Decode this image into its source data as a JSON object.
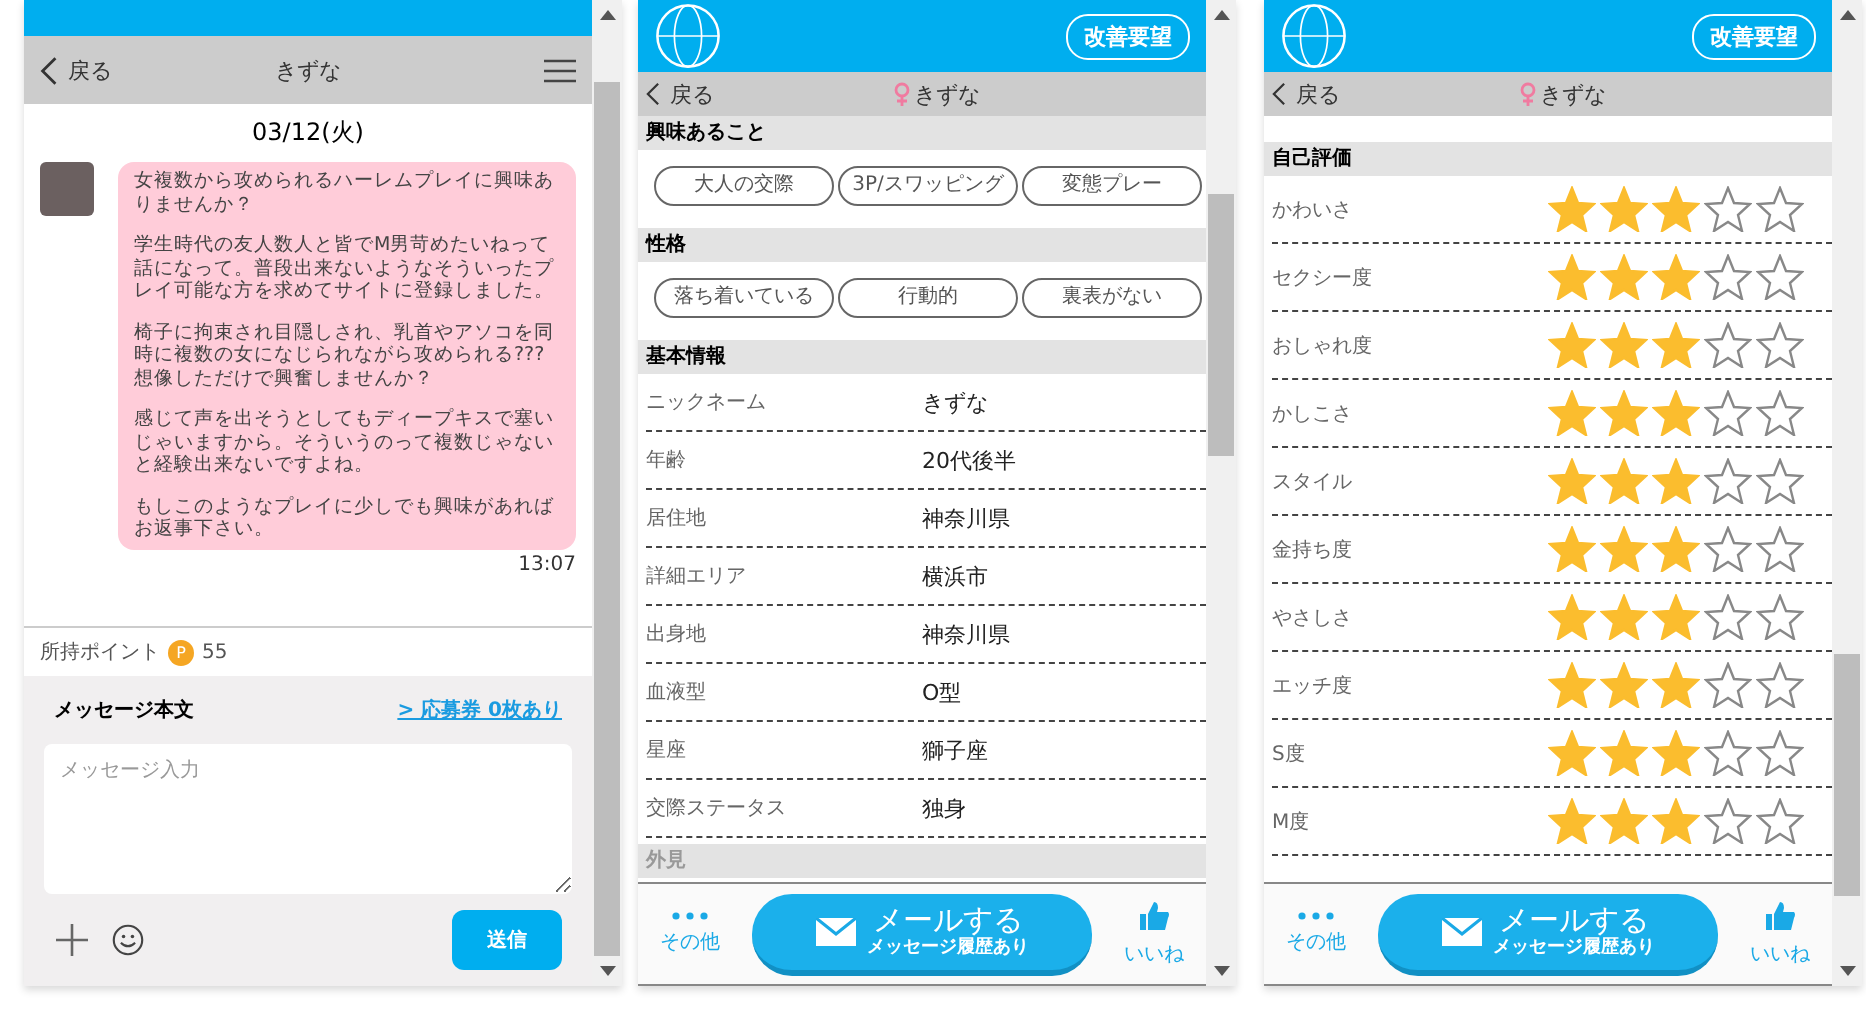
{
  "chat": {
    "back": "戻る",
    "title": "きずな",
    "date": "03/12(火)",
    "message": {
      "paragraphs": [
        "女複数から攻められるハーレムプレイに興味ありませんか？",
        "学生時代の友人数人と皆でM男苛めたいねって話になって。普段出来ないようなそういったプレイ可能な方を求めてサイトに登録しました。",
        "椅子に拘束され目隠しされ、乳首やアソコを同時に複数の女になじられながら攻められる???想像しただけで興奮しませんか？",
        "感じて声を出そうとしてもディープキスで塞いじゃいますから。そういうのって複数じゃないと経験出来ないですよね。",
        "もしこのようなプレイに少しでも興味があればお返事下さい。"
      ],
      "time": "13:07"
    },
    "points_label": "所持ポイント",
    "points_badge": "P",
    "points": "55",
    "composer": {
      "label": "メッセージ本文",
      "coupon_link": "> 応募券 0枚あり",
      "placeholder": "メッセージ入力",
      "send": "送信"
    }
  },
  "profile": {
    "feedback": "改善要望",
    "back": "戻る",
    "name": "きずな",
    "sections": [
      {
        "title": "興味あること",
        "tags": [
          "大人の交際",
          "3P/スワッピング",
          "変態プレー"
        ]
      },
      {
        "title": "性格",
        "tags": [
          "落ち着いている",
          "行動的",
          "裏表がない"
        ]
      }
    ],
    "basic_title": "基本情報",
    "basic": [
      {
        "label": "ニックネーム",
        "value": "きずな"
      },
      {
        "label": "年齢",
        "value": "20代後半"
      },
      {
        "label": "居住地",
        "value": "神奈川県"
      },
      {
        "label": "詳細エリア",
        "value": "横浜市"
      },
      {
        "label": "出身地",
        "value": "神奈川県"
      },
      {
        "label": "血液型",
        "value": "O型"
      },
      {
        "label": "星座",
        "value": "獅子座"
      },
      {
        "label": "交際ステータス",
        "value": "独身"
      }
    ],
    "next_title": "外見",
    "bottom_bar": {
      "more": "その他",
      "mail": "メールする",
      "mail_sub": "メッセージ履歴あり",
      "like": "いいね"
    }
  },
  "ratings_page": {
    "feedback": "改善要望",
    "back": "戻る",
    "name": "きずな",
    "title": "自己評価",
    "ratings": [
      {
        "label": "かわいさ",
        "stars": 3
      },
      {
        "label": "セクシー度",
        "stars": 3
      },
      {
        "label": "おしゃれ度",
        "stars": 3
      },
      {
        "label": "かしこさ",
        "stars": 3
      },
      {
        "label": "スタイル",
        "stars": 3
      },
      {
        "label": "金持ち度",
        "stars": 3
      },
      {
        "label": "やさしさ",
        "stars": 3
      },
      {
        "label": "エッチ度",
        "stars": 3
      },
      {
        "label": "S度",
        "stars": 3
      },
      {
        "label": "M度",
        "stars": 3
      }
    ],
    "bottom_bar": {
      "more": "その他",
      "mail": "メールする",
      "mail_sub": "メッセージ履歴あり",
      "like": "いいね"
    }
  }
}
